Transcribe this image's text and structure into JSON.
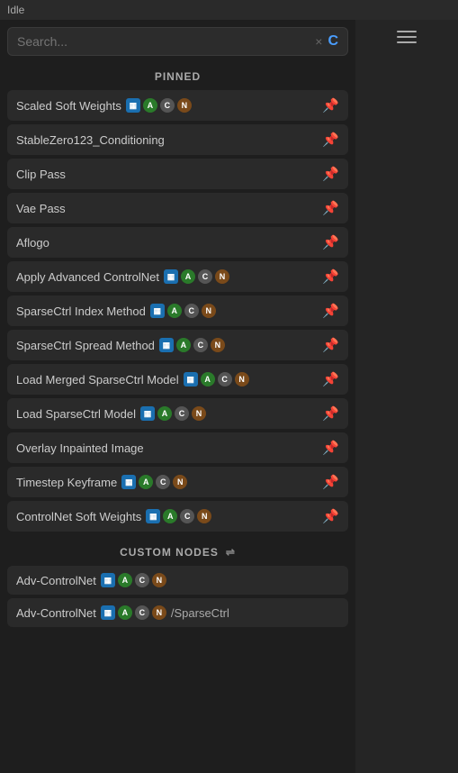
{
  "titleBar": {
    "text": "Idle"
  },
  "search": {
    "placeholder": "Search...",
    "clearLabel": "×",
    "spinnerLabel": "C"
  },
  "sections": {
    "pinned": {
      "label": "PINNED"
    },
    "customNodes": {
      "label": "CUSTOM NODES",
      "iconLabel": "⇌"
    }
  },
  "pinnedItems": [
    {
      "id": "scaled-soft-weights",
      "label": "Scaled Soft Weights",
      "hasBadges": true,
      "badges": [
        "img",
        "A",
        "C",
        "N"
      ],
      "pinned": true
    },
    {
      "id": "stablezero123-conditioning",
      "label": "StableZero123_Conditioning",
      "hasBadges": false,
      "badges": [],
      "pinned": true
    },
    {
      "id": "clip-pass",
      "label": "Clip Pass",
      "hasBadges": false,
      "badges": [],
      "pinned": true
    },
    {
      "id": "vae-pass",
      "label": "Vae Pass",
      "hasBadges": false,
      "badges": [],
      "pinned": true
    },
    {
      "id": "aflogo",
      "label": "Aflogo",
      "hasBadges": false,
      "badges": [],
      "pinned": true
    },
    {
      "id": "apply-advanced-controlnet",
      "label": "Apply Advanced ControlNet",
      "hasBadges": true,
      "badges": [
        "img",
        "A",
        "C",
        "N"
      ],
      "pinned": true
    },
    {
      "id": "sparsectrl-index-method",
      "label": "SparseCtrl Index Method",
      "hasBadges": true,
      "badges": [
        "img",
        "A",
        "C",
        "N"
      ],
      "pinned": true
    },
    {
      "id": "sparsectrl-spread-method",
      "label": "SparseCtrl Spread Method",
      "hasBadges": true,
      "badges": [
        "img",
        "A",
        "C",
        "N"
      ],
      "pinned": true
    },
    {
      "id": "load-merged-sparsectrl-model",
      "label": "Load Merged SparseCtrl Model",
      "hasBadges": true,
      "badges": [
        "img",
        "A",
        "C",
        "N"
      ],
      "pinned": true
    },
    {
      "id": "load-sparsectrl-model",
      "label": "Load SparseCtrl Model",
      "hasBadges": true,
      "badges": [
        "img",
        "A",
        "C",
        "N"
      ],
      "pinned": true
    },
    {
      "id": "overlay-inpainted-image",
      "label": "Overlay Inpainted Image",
      "hasBadges": false,
      "badges": [],
      "pinned": true
    },
    {
      "id": "timestep-keyframe",
      "label": "Timestep Keyframe",
      "hasBadges": true,
      "badges": [
        "img",
        "A",
        "C",
        "N"
      ],
      "pinned": true
    },
    {
      "id": "controlnet-soft-weights",
      "label": "ControlNet Soft Weights",
      "hasBadges": true,
      "badges": [
        "img",
        "A",
        "C",
        "N"
      ],
      "pinned": true
    }
  ],
  "customNodeItems": [
    {
      "id": "adv-controlnet-1",
      "label": "Adv-ControlNet",
      "hasBadges": true,
      "badges": [
        "img",
        "A",
        "C",
        "N"
      ]
    },
    {
      "id": "adv-controlnet-2",
      "label": "Adv-ControlNet",
      "hasBadges": true,
      "badges": [
        "img",
        "A",
        "C",
        "N"
      ],
      "suffix": "/SparseCtrl"
    }
  ]
}
